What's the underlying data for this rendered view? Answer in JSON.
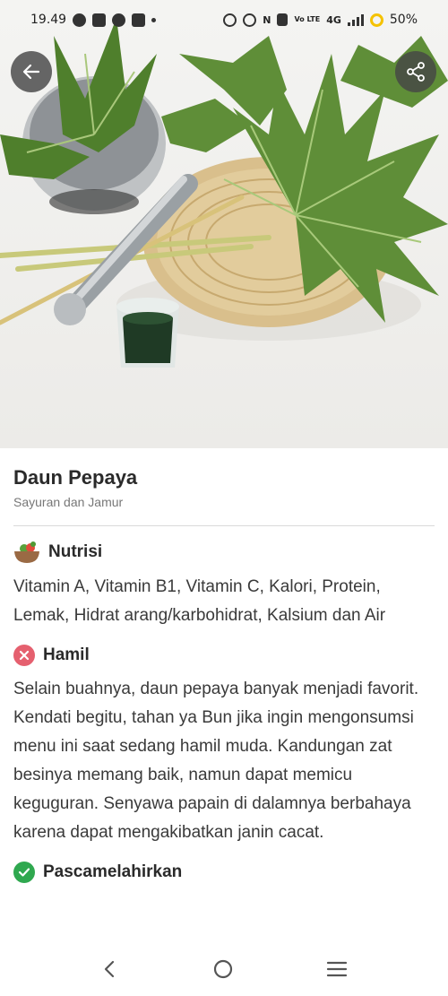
{
  "status_bar": {
    "time": "19.49",
    "network": "4G",
    "volte": "Vo LTE",
    "battery": "50%"
  },
  "hero": {
    "back_icon": "arrow-left-icon",
    "share_icon": "share-icon"
  },
  "item": {
    "title": "Daun Pepaya",
    "category": "Sayuran dan Jamur"
  },
  "sections": {
    "nutrition": {
      "icon": "salad-bowl-icon",
      "label": "Nutrisi",
      "text": "Vitamin A, Vitamin B1, Vitamin C, Kalori, Protein, Lemak, Hidrat arang/karbohidrat, Kalsium dan Air"
    },
    "pregnant": {
      "icon": "x-circle-icon",
      "status_color": "#e5606f",
      "label": "Hamil",
      "text": "Selain buahnya, daun pepaya banyak menjadi favorit. Kendati begitu, tahan ya Bun jika ingin mengonsumsi menu ini saat sedang hamil muda. Kandungan zat besinya memang baik, namun dapat memicu keguguran. Senyawa papain di dalamnya berbahaya karena dapat mengakibatkan janin cacat."
    },
    "postpartum": {
      "icon": "check-circle-icon",
      "status_color": "#2fa84f",
      "label": "Pascamelahirkan"
    }
  },
  "nav_bar": {
    "back_icon": "nav-back-icon",
    "home_icon": "nav-home-icon",
    "recents_icon": "nav-recents-icon"
  }
}
